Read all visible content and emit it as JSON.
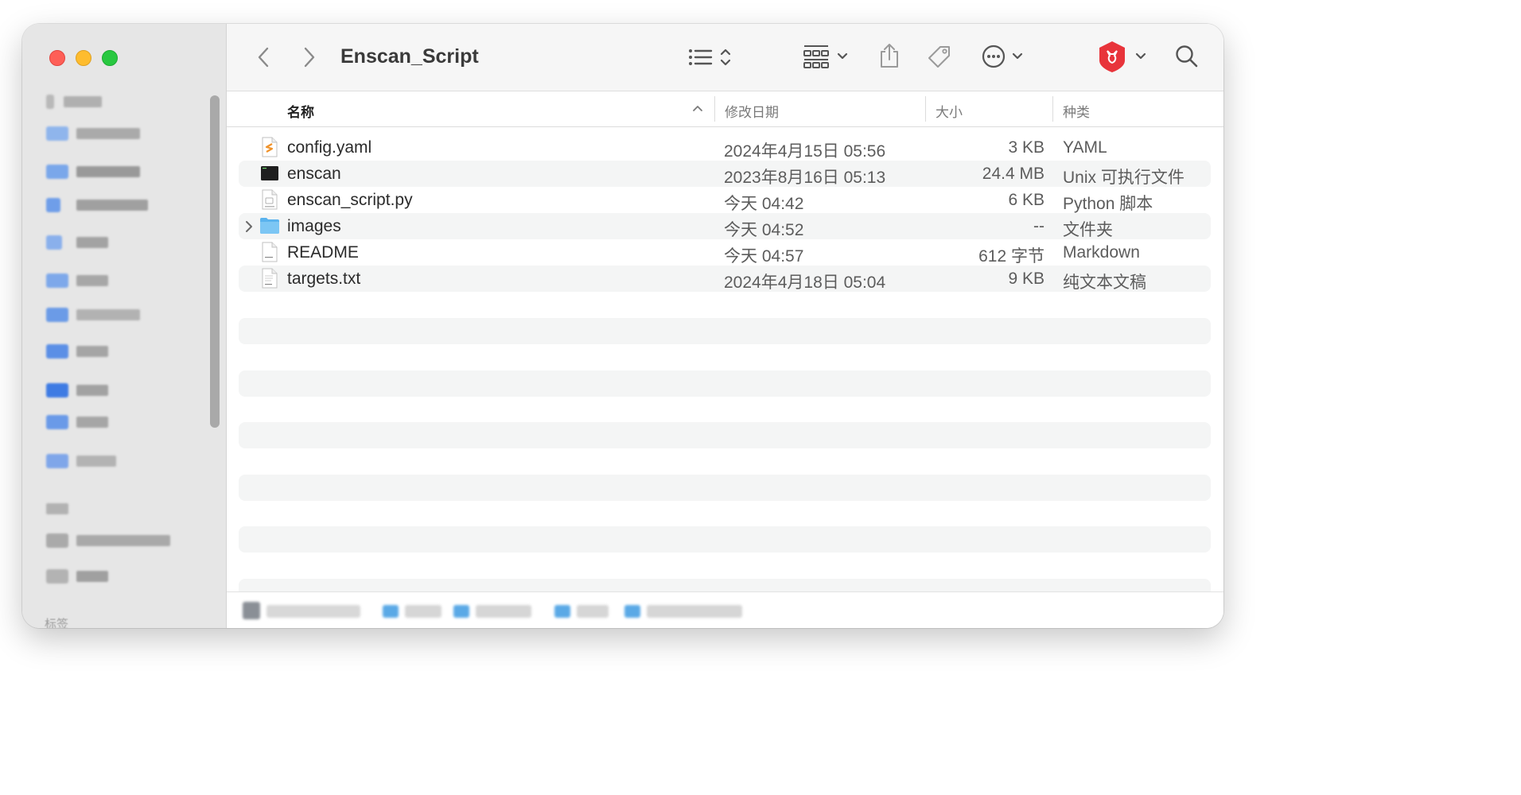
{
  "window": {
    "title": "Enscan_Script"
  },
  "toolbar": {
    "back_icon": "chevron-left-icon",
    "forward_icon": "chevron-right-icon",
    "view_icon": "list-view-icon",
    "group_icon": "grid-group-icon",
    "share_icon": "share-icon",
    "tag_icon": "tag-icon",
    "more_icon": "ellipsis-circle-icon",
    "app_icon": "shield-app-icon",
    "search_icon": "search-icon"
  },
  "columns": {
    "name": "名称",
    "date": "修改日期",
    "size": "大小",
    "kind": "种类"
  },
  "files": [
    {
      "name": "config.yaml",
      "date": "2024年4月15日 05:56",
      "size": "3 KB",
      "kind": "YAML",
      "icon": "yaml-file-icon"
    },
    {
      "name": "enscan",
      "date": "2023年8月16日 05:13",
      "size": "24.4 MB",
      "kind": "Unix 可执行文件",
      "icon": "terminal-exec-icon"
    },
    {
      "name": "enscan_script.py",
      "date": "今天 04:42",
      "size": "6 KB",
      "kind": "Python 脚本",
      "icon": "python-file-icon"
    },
    {
      "name": "images",
      "date": "今天 04:52",
      "size": "--",
      "kind": "文件夹",
      "icon": "folder-icon"
    },
    {
      "name": "README",
      "date": "今天 04:57",
      "size": "612 字节",
      "kind": "Markdown",
      "icon": "markdown-file-icon"
    },
    {
      "name": "targets.txt",
      "date": "2024年4月18日 05:04",
      "size": "9 KB",
      "kind": "纯文本文稿",
      "icon": "text-file-icon"
    }
  ],
  "sidebar": {
    "tags_label": "标签"
  },
  "colors": {
    "close": "#fe5f57",
    "minimize": "#febc2e",
    "zoom": "#28c840",
    "folder_blue": "#5ab3ee",
    "app_red": "#e8343b"
  }
}
